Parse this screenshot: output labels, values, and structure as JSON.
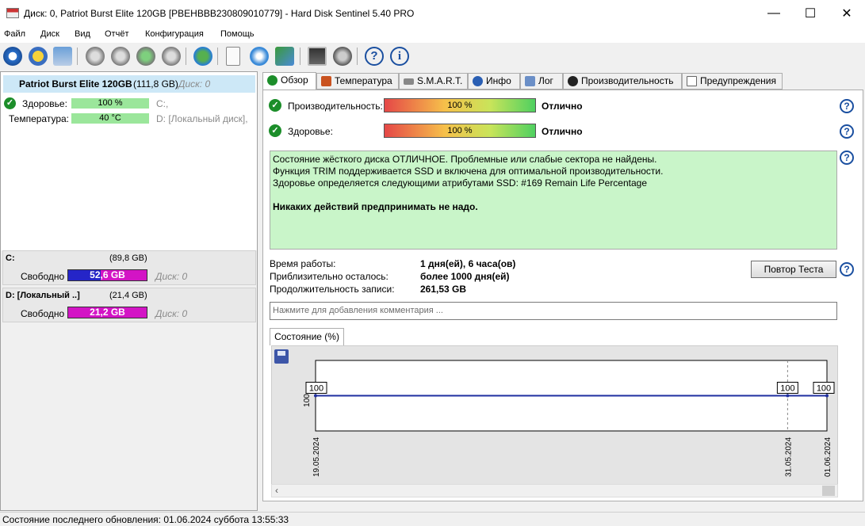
{
  "window": {
    "title": "Диск: 0, Patriot Burst Elite 120GB [PBEHBBB230809010779]  -  Hard Disk Sentinel 5.40 PRO",
    "minimize_glyph": "—",
    "maximize_glyph": "☐",
    "close_glyph": "✕"
  },
  "menu": [
    "Файл",
    "Диск",
    "Вид",
    "Отчёт",
    "Конфигурация",
    "Помощь"
  ],
  "toolbar_icons": [
    "refresh-icon",
    "warning-icon",
    "disk-icon",
    "disk-1-icon",
    "disk-2-icon",
    "disk-3-icon",
    "disk-4-icon",
    "globe-icon",
    "document-icon",
    "sync-icon",
    "network-icon",
    "monitor-icon",
    "speaker-icon",
    "help-icon",
    "info-icon"
  ],
  "disk": {
    "name": "Patriot Burst Elite 120GB",
    "size": "(111,8 GB)",
    "disk_label": "Диск: 0",
    "health_label": "Здоровье:",
    "health_value": "100 %",
    "health_volume": "C:,",
    "temp_label": "Температура:",
    "temp_value": "40 °C",
    "temp_volume": "D: [Локальный диск],"
  },
  "volumes": [
    {
      "name": "C:",
      "size": "(89,8 GB)",
      "free_label": "Свободно",
      "free": "52,6 GB",
      "disk": "Диск: 0",
      "color": "#2525c8"
    },
    {
      "name": "D: [Локальный ..]",
      "size": "(21,4 GB)",
      "free_label": "Свободно",
      "free": "21,2 GB",
      "disk": "Диск: 0",
      "color": "#d314c5"
    }
  ],
  "volume_fill": [
    0.41,
    0.01
  ],
  "tabs": [
    "Обзор",
    "Температура",
    "S.M.A.R.T.",
    "Инфо",
    "Лог",
    "Производительность",
    "Предупреждения"
  ],
  "overview": {
    "performance_label": "Производительность:",
    "performance_value": "100 %",
    "performance_rating": "Отлично",
    "health_label": "Здоровье:",
    "health_value": "100 %",
    "health_rating": "Отлично",
    "status_lines": [
      "Состояние жёсткого диска ОТЛИЧНОЕ. Проблемные или слабые сектора не найдены.",
      "Функция TRIM поддерживается SSD и включена для оптимальной производительности.",
      "Здоровье определяется следующими атрибутами SSD: #169 Remain Life Percentage"
    ],
    "status_bold": "Никаких действий предпринимать не надо.",
    "uptime_label": "Время работы:",
    "uptime_value": "1 дня(ей), 6 часа(ов)",
    "remaining_label": "Приблизительно осталось:",
    "remaining_value": "более 1000 дня(ей)",
    "written_label": "Продолжительность записи:",
    "written_value": "261,53 GB",
    "retest_button": "Повтор Теста",
    "comment_placeholder": "Нажмите для добавления комментария ...",
    "chart_tab": "Состояние (%)"
  },
  "chart_data": {
    "type": "line",
    "x": [
      "19.05.2024",
      "31.05.2024",
      "01.06.2024"
    ],
    "series": [
      {
        "values": [
          100,
          100,
          100
        ]
      }
    ],
    "ylabel": "100",
    "data_labels": [
      "100",
      "100",
      "100"
    ]
  },
  "statusbar": "Состояние последнего обновления: 01.06.2024 суббота 13:55:33"
}
